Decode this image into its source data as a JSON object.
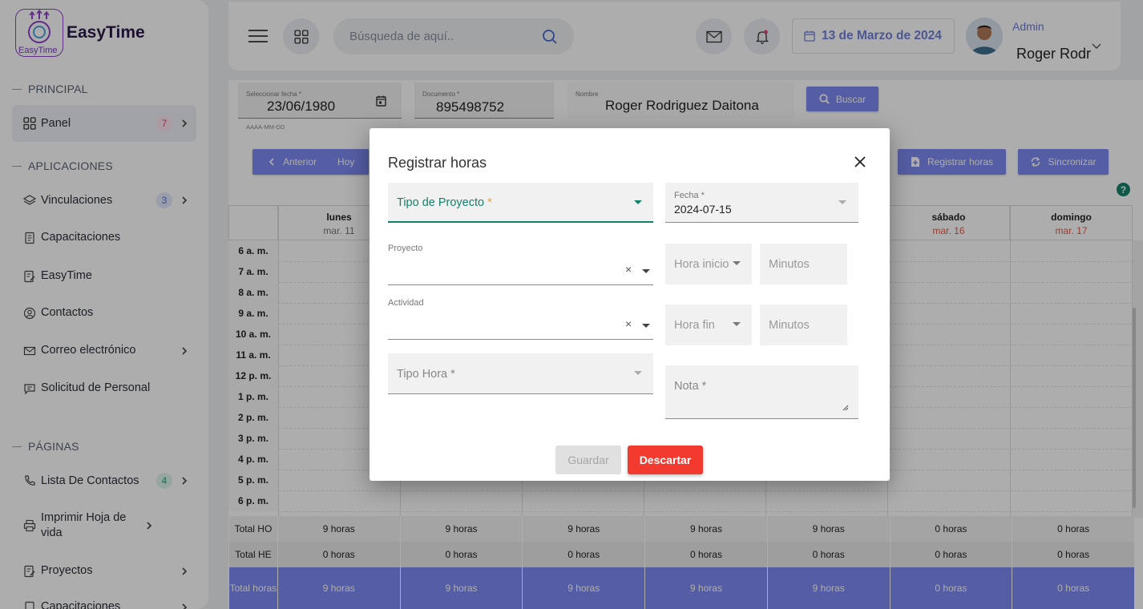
{
  "sidebar": {
    "brand": "EasyTime",
    "logo_text": "EasyTime",
    "sections": {
      "principal": "PRINCIPAL",
      "aplicaciones": "APLICACIONES",
      "paginas": "PÁGINAS"
    },
    "items": {
      "panel": {
        "label": "Panel",
        "badge": "7",
        "icon": "grid-icon"
      },
      "vinculaciones": {
        "label": "Vinculaciones",
        "badge": "3",
        "icon": "layers-icon"
      },
      "capacitaciones": {
        "label": "Capacitaciones",
        "icon": "document-icon"
      },
      "easytime": {
        "label": "EasyTime",
        "icon": "edit-document-icon"
      },
      "contactos": {
        "label": "Contactos",
        "icon": "user-circle-icon"
      },
      "correo": {
        "label": "Correo electrónico",
        "icon": "mail-icon"
      },
      "solicitud": {
        "label": "Solicitud de Personal",
        "icon": "chat-icon"
      },
      "lista": {
        "label": "Lista De Contactos",
        "badge": "4",
        "icon": "phone-icon"
      },
      "imprimir": {
        "label": "Imprimir Hoja de vida",
        "icon": "printer-icon"
      },
      "proyectos": {
        "label": "Proyectos",
        "icon": "edit-document-icon"
      },
      "capacitaciones2": {
        "label": "Capacitaciones",
        "icon": "document-icon"
      }
    },
    "colors": {
      "badge_pink": "#fde4ee",
      "badge_pink_text": "#e0457b",
      "badge_blue": "#e4e8fb",
      "badge_blue_text": "#5b6bd6",
      "badge_green": "#dcf5ec",
      "badge_green_text": "#25a57a"
    }
  },
  "topbar": {
    "search_placeholder": "Búsqueda de aquí..",
    "date": "13 de Marzo de 2024",
    "role": "Admin",
    "user_name": "Roger Rodr"
  },
  "filters": {
    "date_label": "Seleccionar fecha *",
    "date_value": "23/06/1980",
    "date_hint": "AAAA-MM-DD",
    "doc_label": "Documento *",
    "doc_value": "895498752",
    "name_label": "Nombre",
    "name_value": "Roger Rodriguez Daitona",
    "search_button": "Buscar"
  },
  "toolbar": {
    "prev": "Anterior",
    "today": "Hoy",
    "register": "Registrar horas",
    "sync": "Sincronizar"
  },
  "calendar": {
    "days": [
      {
        "name": "lunes",
        "date": "mar. 11"
      },
      {
        "name": "",
        "date": ""
      },
      {
        "name": "",
        "date": ""
      },
      {
        "name": "",
        "date": ""
      },
      {
        "name": "",
        "date": ""
      },
      {
        "name": "sábado",
        "date": "mar. 16"
      },
      {
        "name": "domingo",
        "date": "mar. 17"
      }
    ],
    "hours": [
      "6 a. m.",
      "7 a. m.",
      "8 a. m.",
      "9 a. m.",
      "10 a. m.",
      "11 a. m.",
      "12 p. m.",
      "1 p. m.",
      "2 p. m.",
      "3 p. m.",
      "4 p. m.",
      "5 p. m.",
      "6 p. m."
    ]
  },
  "totals": {
    "ho_label": "Total HO",
    "he_label": "Total HE",
    "total_label": "Total horas",
    "ho": [
      "9 horas",
      "9 horas",
      "9 horas",
      "9 horas",
      "9 horas",
      "0 horas",
      "0 horas"
    ],
    "he": [
      "0 horas",
      "0 horas",
      "0 horas",
      "0 horas",
      "0 horas",
      "0 horas",
      "0 horas"
    ],
    "total": [
      "9 horas",
      "9 horas",
      "9 horas",
      "9 horas",
      "9 horas",
      "0 horas",
      "0 horas"
    ]
  },
  "modal": {
    "title": "Registrar horas",
    "tipo_proyecto": "Tipo de Proyecto",
    "required_mark": "*",
    "fecha_label": "Fecha *",
    "fecha_value": "2024-07-15",
    "proyecto_label": "Proyecto",
    "actividad_label": "Actividad",
    "hora_inicio": "Hora inicio",
    "hora_fin": "Hora fin",
    "minutos": "Minutos",
    "tipo_hora": "Tipo Hora *",
    "nota": "Nota *",
    "clear_mark": "×",
    "save": "Guardar",
    "discard": "Descartar",
    "colors": {
      "accent": "#17806b",
      "discard": "#f33a2e",
      "button": "#7e8af2"
    }
  }
}
